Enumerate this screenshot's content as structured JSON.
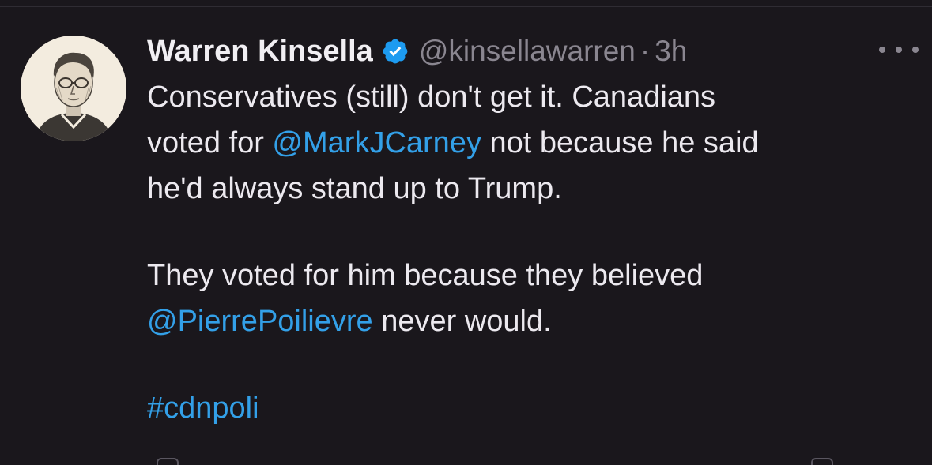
{
  "tweet": {
    "author_name": "Warren Kinsella",
    "handle": "@kinsellawarren",
    "separator": "·",
    "time": "3h",
    "line1": "Conservatives (still) don't get it. Canadians",
    "line2_pre": "voted for ",
    "line2_mention": "@MarkJCarney",
    "line2_post": " not because he said",
    "line3": "he'd always stand up to Trump.",
    "line4": "They voted for him because they believed",
    "line5_mention": "@PierrePoilievre",
    "line5_post": " never would.",
    "hashtag": "#cdnpoli"
  },
  "icons": {
    "verified": "verified-badge-icon",
    "more": "more-horizontal-icon"
  },
  "colors": {
    "background": "#1a171c",
    "link": "#33a0e8",
    "verified": "#1d9bf0",
    "muted": "#8a8690"
  }
}
